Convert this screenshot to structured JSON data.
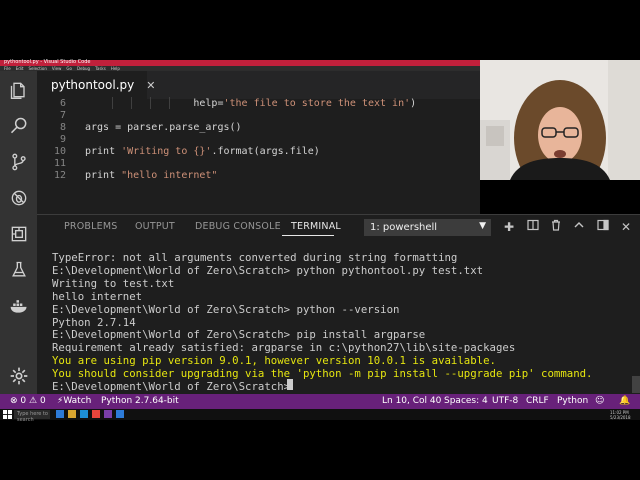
{
  "window": {
    "title": "pythontool.py - Visual Studio Code",
    "menu": [
      "File",
      "Edit",
      "Selection",
      "View",
      "Go",
      "Debug",
      "Tasks",
      "Help"
    ]
  },
  "tab": {
    "label": "pythontool.py"
  },
  "editor": {
    "lines": [
      {
        "num": "6",
        "pre": "                  help=",
        "str": "'the file to store the text in'",
        "post": ")"
      },
      {
        "num": "7",
        "pre": "",
        "str": "",
        "post": ""
      },
      {
        "num": "8",
        "pre": "args = parser.parse_args()",
        "str": "",
        "post": ""
      },
      {
        "num": "9",
        "pre": "",
        "str": "",
        "post": ""
      },
      {
        "num": "10",
        "pre": "print ",
        "str": "'Writing to {}'",
        "post": ".format(args.file)"
      },
      {
        "num": "11",
        "pre": "",
        "str": "",
        "post": ""
      },
      {
        "num": "12",
        "pre": "print ",
        "str": "\"hello internet\"",
        "post": ""
      }
    ]
  },
  "panel": {
    "tabs": [
      "PROBLEMS",
      "OUTPUT",
      "DEBUG CONSOLE",
      "TERMINAL"
    ],
    "active_tab": "TERMINAL",
    "terminal_select": "1: powershell",
    "terminal_lines": [
      "TypeError: not all arguments converted during string formatting",
      "E:\\Development\\World of Zero\\Scratch> python pythontool.py test.txt",
      "Writing to test.txt",
      "hello internet",
      "E:\\Development\\World of Zero\\Scratch> python --version",
      "Python 2.7.14",
      "E:\\Development\\World of Zero\\Scratch> pip install argparse",
      "Requirement already satisfied: argparse in c:\\python27\\lib\\site-packages",
      "You are using pip version 9.0.1, however version 10.0.1 is available.",
      "You should consider upgrading via the 'python -m pip install --upgrade pip' command.",
      "E:\\Development\\World of Zero\\Scratch> "
    ]
  },
  "statusbar": {
    "errors": "0",
    "warnings": "0",
    "watch": "Watch",
    "interpreter": "Python 2.7.64-bit",
    "position": "Ln 10, Col 40",
    "spaces": "Spaces: 4",
    "encoding": "UTF-8",
    "eol": "CRLF",
    "language": "Python"
  },
  "taskbar": {
    "search": "Type here to search",
    "time": "11:02 PM",
    "date": "5/23/2018"
  },
  "colors": {
    "statusbar": "#68217a",
    "titlebar": "#c1203b",
    "warning_text": "#e5e510"
  }
}
